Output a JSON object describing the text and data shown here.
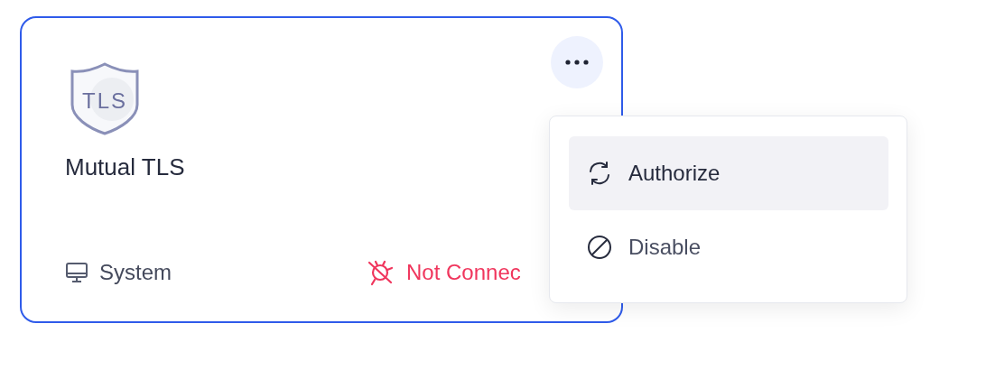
{
  "card": {
    "logo_text": "TLS",
    "title": "Mutual TLS",
    "source": "System",
    "status": "Not Connec"
  },
  "menu": {
    "items": [
      {
        "kind": "authorize",
        "label": "Authorize",
        "selected": true
      },
      {
        "kind": "disable",
        "label": "Disable",
        "selected": false
      }
    ]
  }
}
